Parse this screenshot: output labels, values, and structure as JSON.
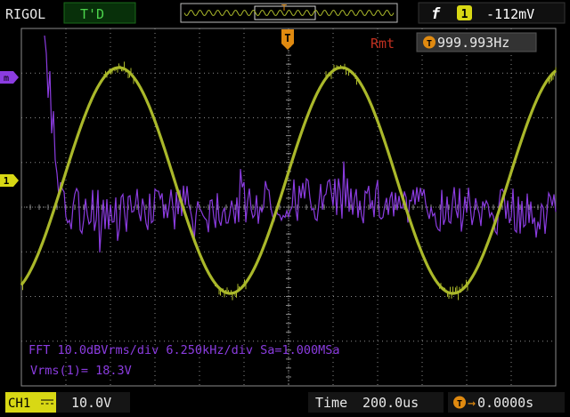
{
  "header": {
    "brand": "RIGOL",
    "run_status": "T'D",
    "trigger_marker": "T",
    "trigger_edge_symbol": "f",
    "trigger_source": "1",
    "trigger_level": "-112mV"
  },
  "measurement": {
    "label": "Rmt",
    "freq_icon": "T",
    "frequency": "999.993Hz"
  },
  "markers": {
    "math_marker": "m",
    "ch1_marker": "1",
    "trigger_pos_marker": "T"
  },
  "fft_info": {
    "line": "FFT 10.0dBVrms/div 6.250kHz/div Sa=1.000MSa",
    "vrms": "Vrms(1)= 18.3V"
  },
  "footer": {
    "channel": "CH1",
    "channel_scale": "10.0V",
    "time_label": "Time",
    "time_value": "200.0us",
    "trigger_offset_icon": "T",
    "trigger_offset": "0.0000s"
  },
  "colors": {
    "grid": "#8a8a8a",
    "sine_trace": "#aab82a",
    "fft_trace": "#8b3ce0",
    "rmt_label": "#c03020",
    "trigger_orange": "#e08a10",
    "status_green": "#4cd44c"
  },
  "trace_data": {
    "sine": {
      "frequency_hz": 1000,
      "period_us": 1000,
      "time_per_div_us": 200,
      "volts_per_div": 10
    },
    "fft": {
      "db_per_div": 10,
      "hz_per_div": 6250,
      "sample_rate": "1.000MSa"
    }
  }
}
